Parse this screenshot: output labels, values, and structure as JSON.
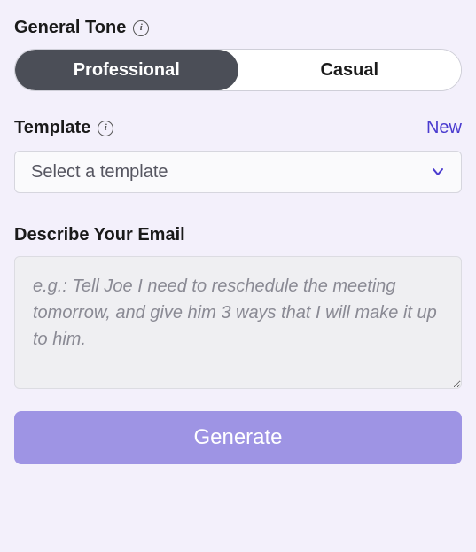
{
  "tone": {
    "label": "General Tone",
    "options": {
      "professional": "Professional",
      "casual": "Casual"
    }
  },
  "template": {
    "label": "Template",
    "new_link": "New",
    "placeholder": "Select a template"
  },
  "describe": {
    "label": "Describe Your Email",
    "placeholder": "e.g.: Tell Joe I need to reschedule the meeting tomorrow, and give him 3 ways that I will make it up to him."
  },
  "generate_label": "Generate",
  "icons": {
    "info_glyph": "i"
  }
}
